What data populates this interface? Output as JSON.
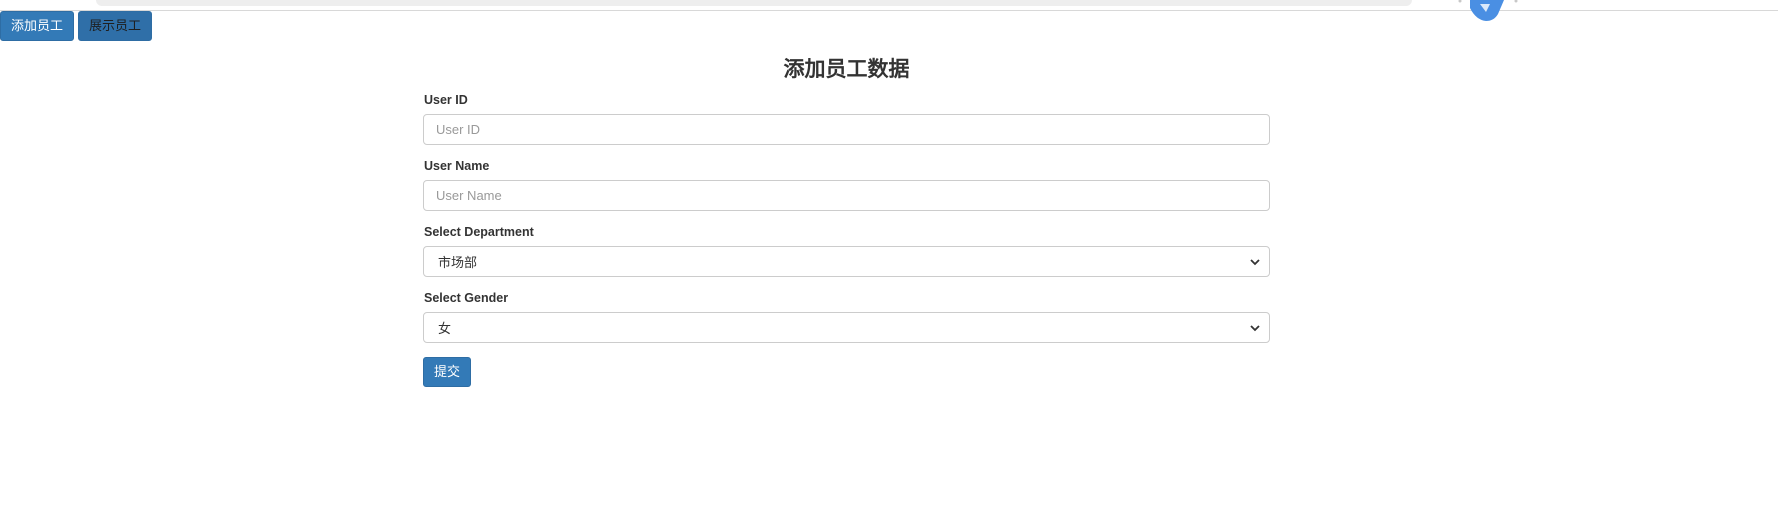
{
  "nav": {
    "add_label": "添加员工",
    "show_label": "展示员工"
  },
  "form": {
    "title": "添加员工数据",
    "user_id": {
      "label": "User ID",
      "placeholder": "User ID",
      "value": ""
    },
    "user_name": {
      "label": "User Name",
      "placeholder": "User Name",
      "value": ""
    },
    "department": {
      "label": "Select Department",
      "selected": "市场部"
    },
    "gender": {
      "label": "Select Gender",
      "selected": "女"
    },
    "submit_label": "提交"
  },
  "icons": {
    "chevron": "chevron-down-icon",
    "extension": "extension-icon"
  },
  "colors": {
    "primary": "#337ab7",
    "primary_border": "#2e6da4",
    "border": "#cccccc",
    "text": "#333333"
  }
}
